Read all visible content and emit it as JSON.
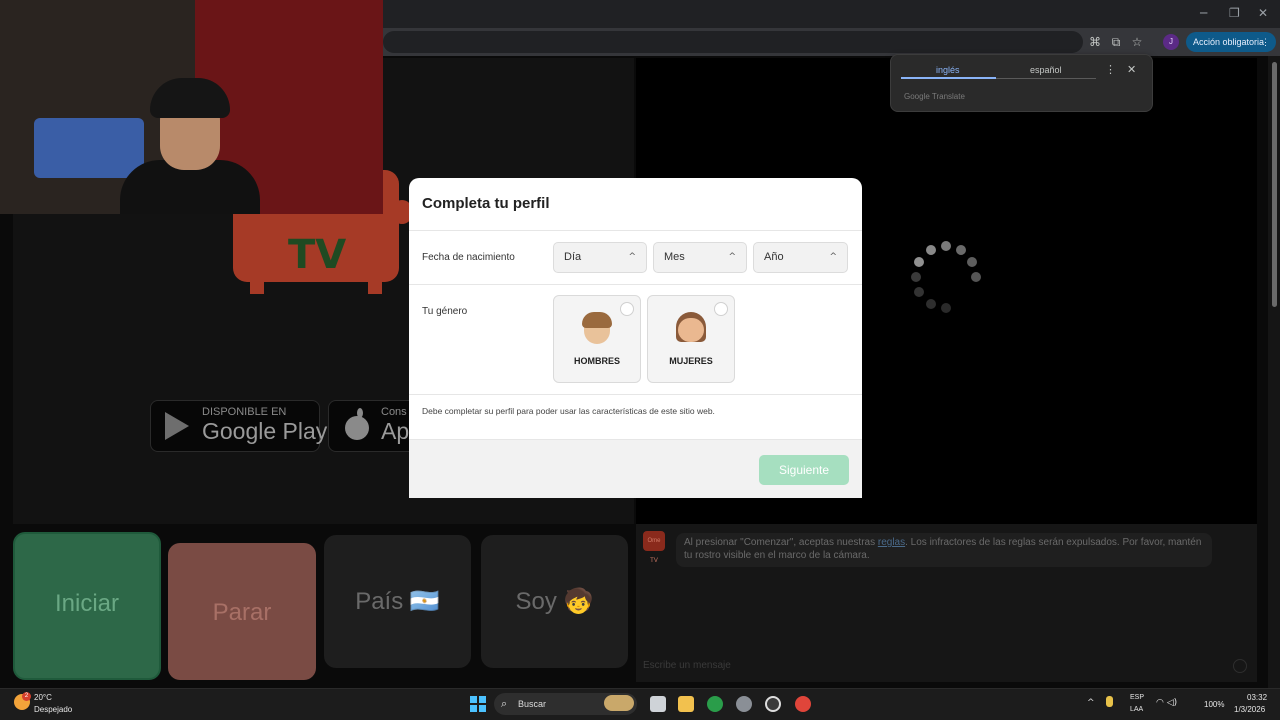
{
  "browser": {
    "window_controls": [
      "─",
      "❐",
      "✕"
    ],
    "translate_icon": "translate-icon",
    "cast_icon": "cast-icon",
    "bookmark_icon": "star-icon",
    "profile_initial": "J",
    "action_button": "Acción obligatoria",
    "translate_popup": {
      "tab_source": "inglés",
      "tab_target": "español",
      "brand": "Google Translate"
    }
  },
  "site": {
    "logo_text": "TV",
    "google_play": {
      "small": "DISPONIBLE EN",
      "big": "Google Play"
    },
    "app_store": {
      "small": "Cons",
      "big": "Ap"
    },
    "buttons": {
      "iniciar": "Iniciar",
      "parar": "Parar",
      "pais": "País 🇦🇷",
      "soy": "Soy 🧒"
    },
    "chat": {
      "avatar_text": "Ome TV",
      "message_pre": "Al presionar \"Comenzar\", aceptas nuestras ",
      "message_link": "reglas",
      "message_post": ". Los infractores de las reglas serán expulsados. Por favor, mantén tu rostro visible en el marco de la cámara.",
      "input_placeholder": "Escribe un mensaje"
    }
  },
  "modal": {
    "title": "Completa tu perfil",
    "birth_label": "Fecha de nacimiento",
    "day_select": "Día",
    "month_select": "Mes",
    "year_select": "Año",
    "gender_label": "Tu género",
    "gender_male": "HOMBRES",
    "gender_female": "MUJERES",
    "notice": "Debe completar su perfil para poder usar las características de este sitio web.",
    "next_button": "Siguiente"
  },
  "taskbar": {
    "weather_badge": "2",
    "temperature": "20°C",
    "condition": "Despejado",
    "search_placeholder": "Buscar",
    "lang_line1": "ESP",
    "lang_line2": "LAA",
    "battery": "100%",
    "time": "03:32",
    "date": "1/3/2026"
  },
  "colors": {
    "accent_green": "#a6dfc0",
    "brand_red": "#a63a26",
    "translate_blue": "#8ab4f8",
    "action_button_blue": "#0e5a8a"
  }
}
